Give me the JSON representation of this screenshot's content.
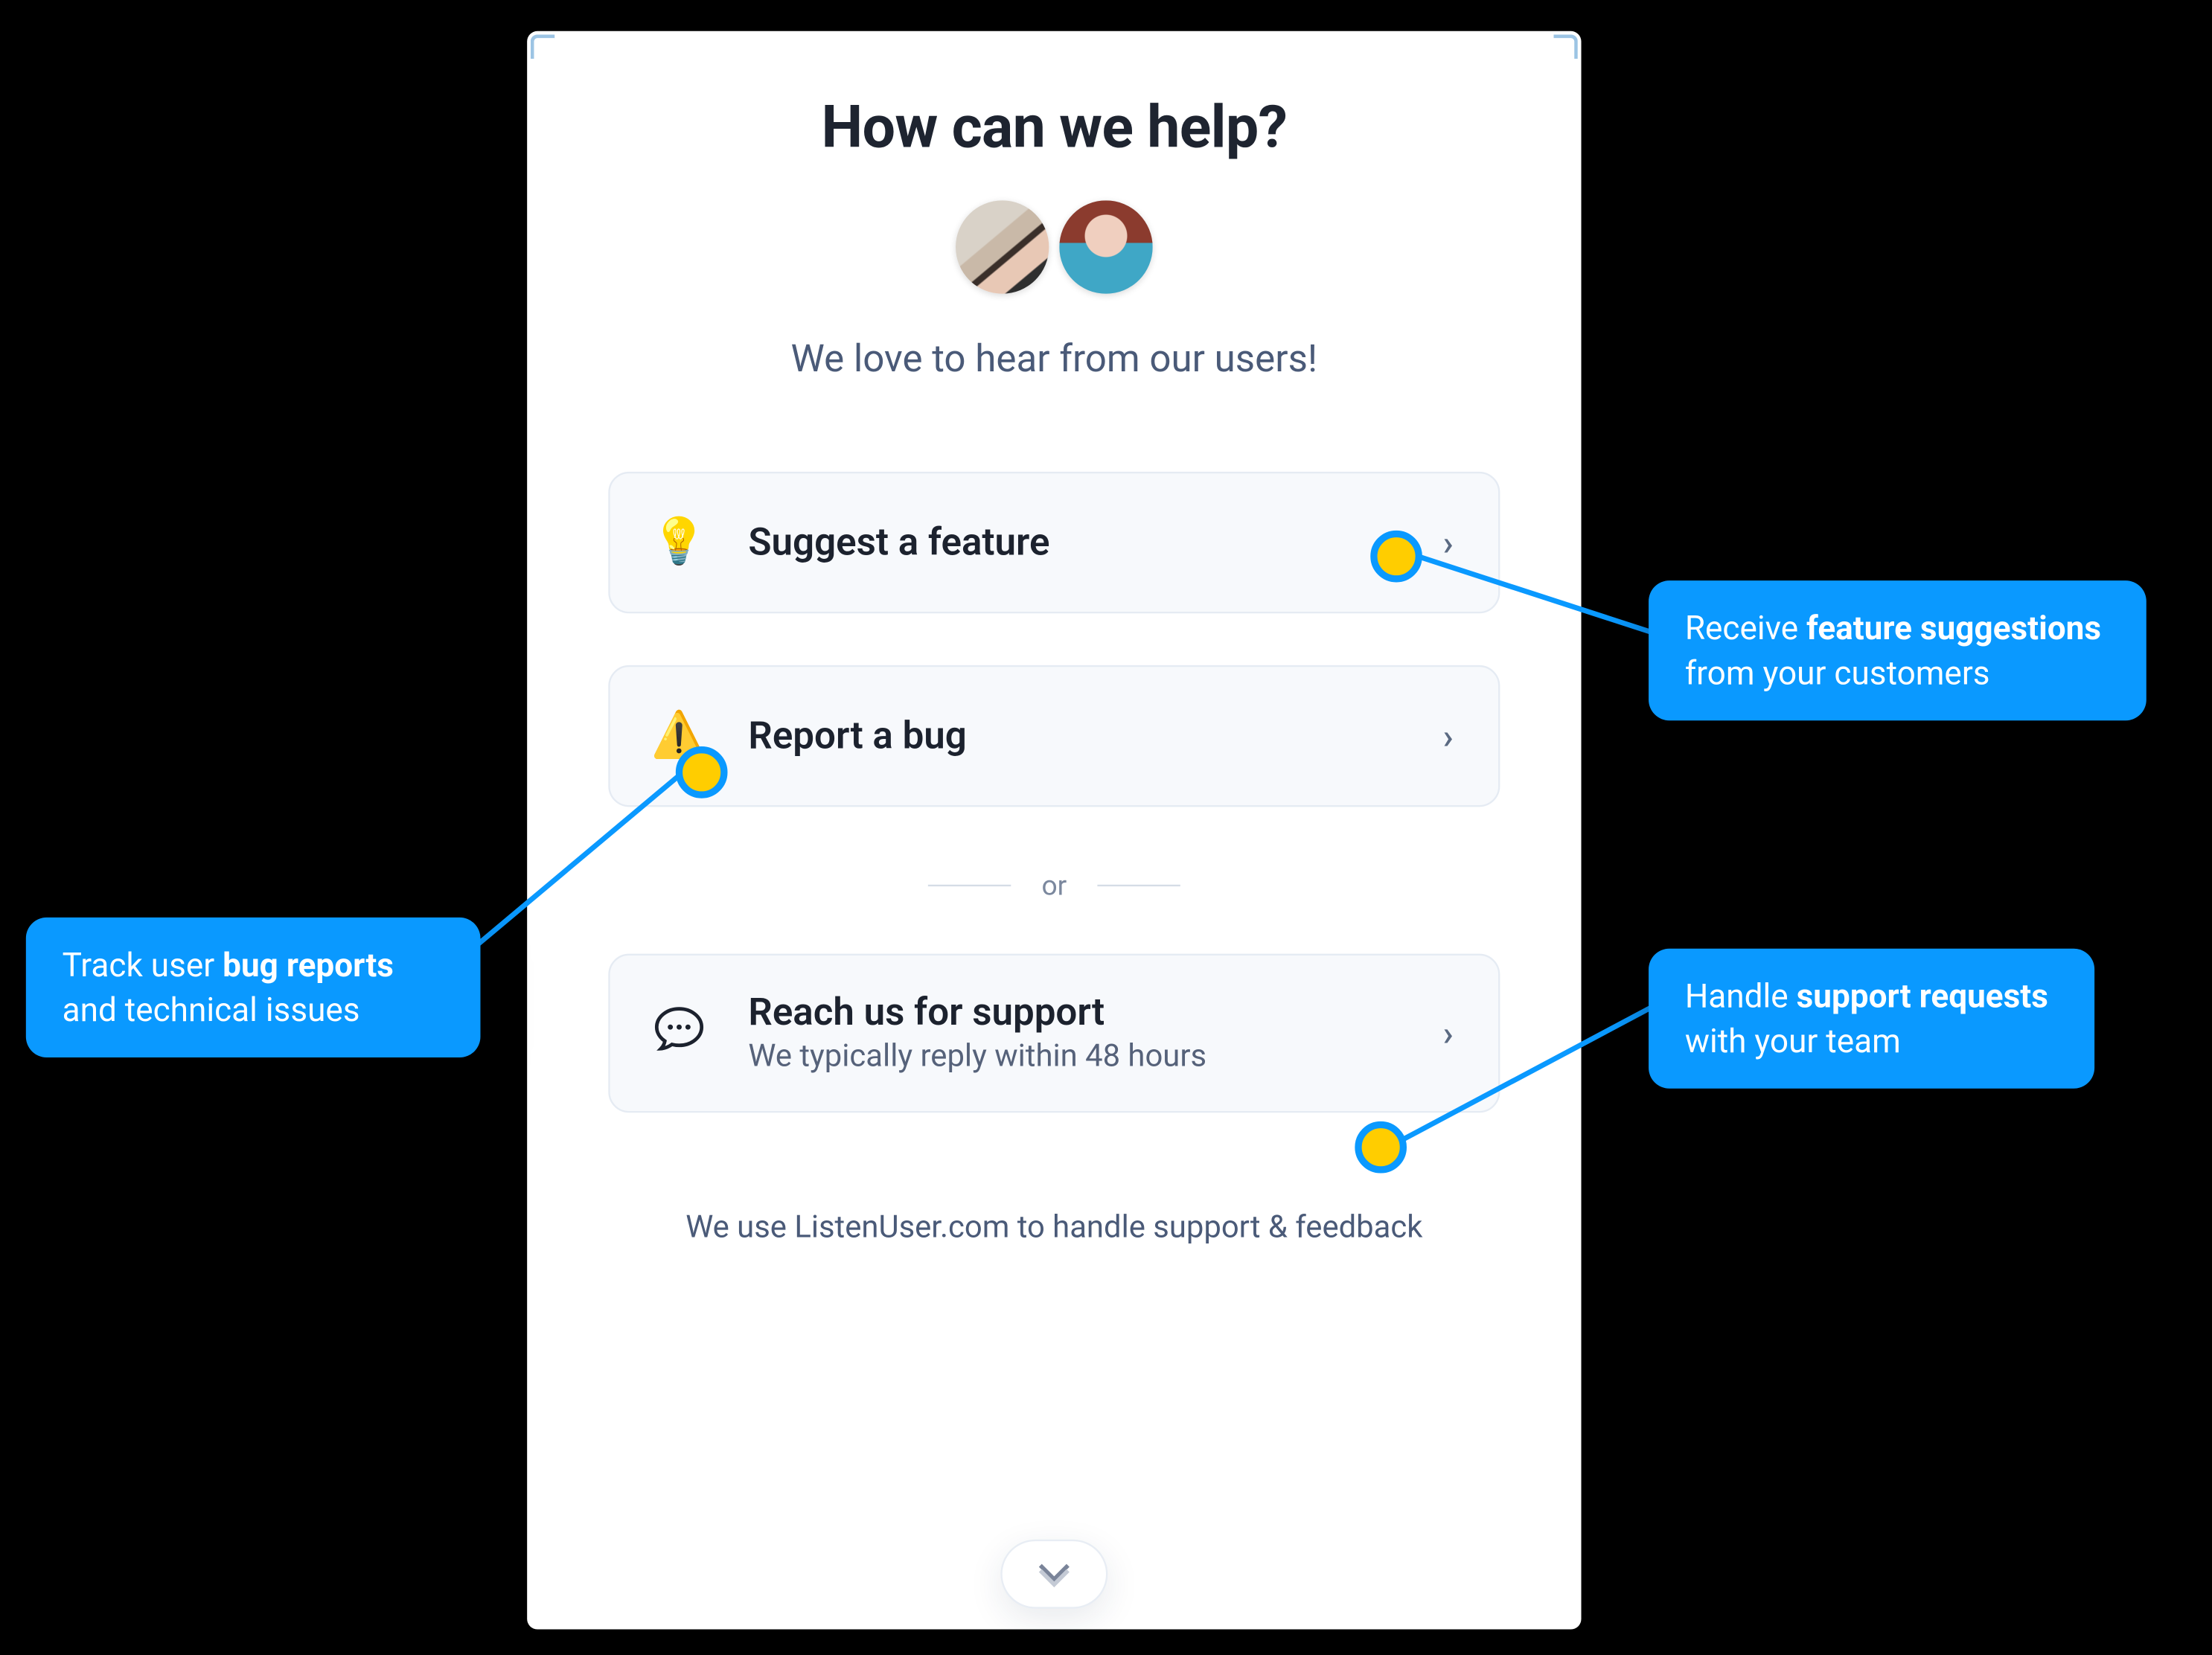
{
  "widget": {
    "title": "How can we help?",
    "subtitle": "We love to hear from our users!",
    "or_label": "or",
    "footer": "We use ListenUser.com to handle support & feedback",
    "options": [
      {
        "icon": "💡",
        "title": "Suggest a feature",
        "sub": ""
      },
      {
        "icon": "⚠️",
        "title": "Report a bug",
        "sub": ""
      },
      {
        "icon": "chat",
        "title": "Reach us for support",
        "sub": "We typically reply within 48 hours"
      }
    ]
  },
  "callouts": {
    "feature": {
      "pre": "Receive ",
      "bold": "feature suggestions",
      "post": " from your customers"
    },
    "bug": {
      "pre": "Track user ",
      "bold": "bug reports",
      "post": " and technical issues"
    },
    "support": {
      "pre": "Handle ",
      "bold": "support requests",
      "post": " with your team"
    }
  }
}
